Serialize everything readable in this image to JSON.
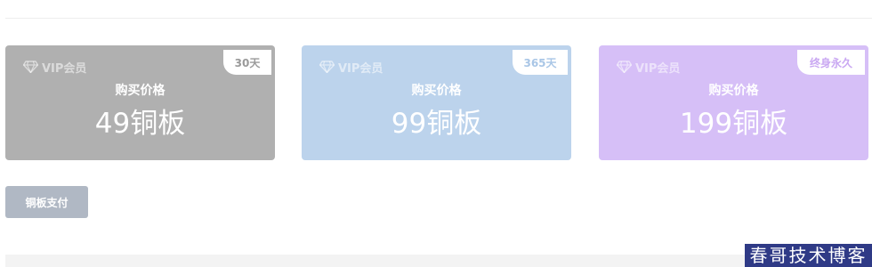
{
  "plans": [
    {
      "vip_label": "VIP会员",
      "duration": "30天",
      "price_caption": "购买价格",
      "price": "49铜板",
      "color": "#b0b0b0"
    },
    {
      "vip_label": "VIP会员",
      "duration": "365天",
      "price_caption": "购买价格",
      "price": "99铜板",
      "color": "#bcd3ec"
    },
    {
      "vip_label": "VIP会员",
      "duration": "终身永久",
      "price_caption": "购买价格",
      "price": "199铜板",
      "color": "#d6bff7"
    }
  ],
  "actions": {
    "pay_label": "铜板支付"
  },
  "watermark": {
    "text": "春哥技术博客"
  },
  "icons": {
    "vip": "diamond-icon"
  }
}
